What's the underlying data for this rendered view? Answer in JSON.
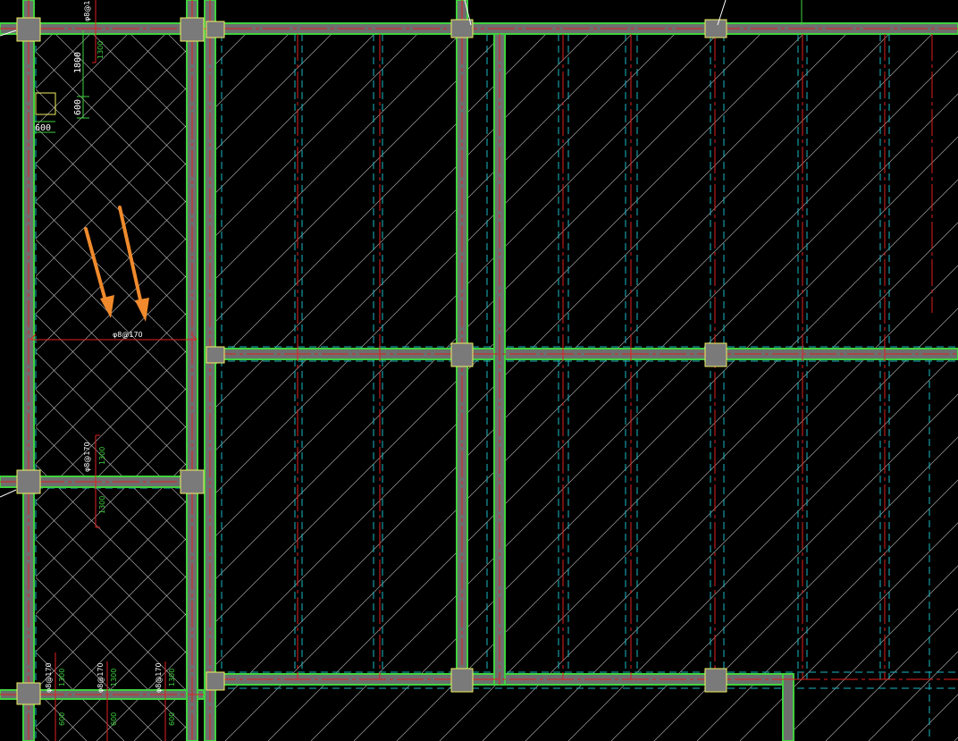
{
  "colors": {
    "background": "#000000",
    "beam_fill": "#6e6e6e",
    "beam_edge": "#3fd13f",
    "rebar_line": "#e02020",
    "dashed_line": "#17b8c4",
    "hatch_line": "#d8d8d8",
    "dim_line": "#3fd13f",
    "rebar_mark": "#e02020",
    "column_fill": "#7a7a7a",
    "column_edge": "#f0f060",
    "arrow": "#f08a2c",
    "text": "#ffffff"
  },
  "dimensions": {
    "d1800": "1800",
    "d600v": "600",
    "d600h": "600",
    "d1300_top": "1300",
    "d1300_mid_a": "1300",
    "d1300_mid_b": "1300",
    "d1300_b1": "1300",
    "d1300_b2": "1300",
    "d1300_b3": "1300",
    "d600_b1": "600",
    "d600_b2": "600",
    "d600_b3": "600"
  },
  "rebar_notes": {
    "top": "φ8@1",
    "main": "φ8@170",
    "mid": "φ8@170",
    "bottom_1": "φ8@170",
    "bottom_2": "φ8@170",
    "bottom_3": "φ8@170"
  },
  "icons": {
    "arrow_left": "arrow-down-right-icon",
    "arrow_right": "arrow-down-right-icon"
  }
}
